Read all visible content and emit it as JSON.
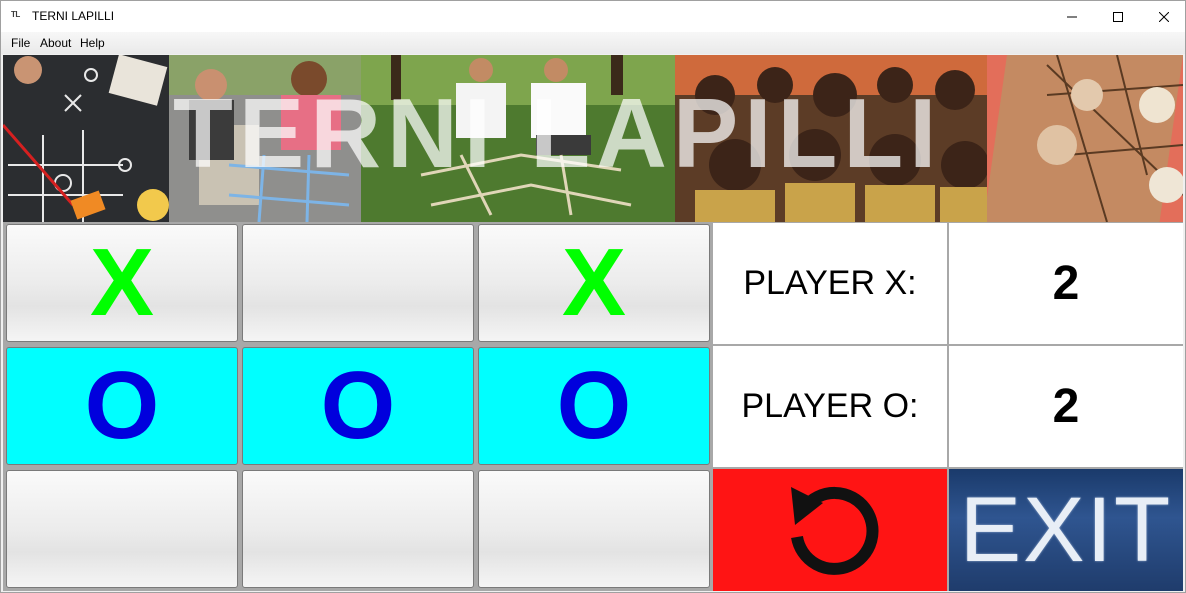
{
  "window": {
    "title": "TERNI LAPILLI",
    "icon_text": "TL"
  },
  "menu": [
    "File",
    "About",
    "Help"
  ],
  "banner": {
    "title": "TERNI LAPILLI"
  },
  "board": [
    [
      "X",
      "",
      "X"
    ],
    [
      "O",
      "O",
      "O"
    ],
    [
      "",
      "",
      ""
    ]
  ],
  "scores": [
    {
      "label": "PLAYER X:",
      "value": "2"
    },
    {
      "label": "PLAYER O:",
      "value": "2"
    }
  ],
  "controls": {
    "exit_label": "EXIT",
    "reset_icon": "reset-icon"
  },
  "colors": {
    "x_mark": "#00ff00",
    "o_mark": "#0000dd",
    "o_cell": "#00ffff",
    "reset_bg": "#ff1414",
    "exit_bg": "#2f5590"
  }
}
